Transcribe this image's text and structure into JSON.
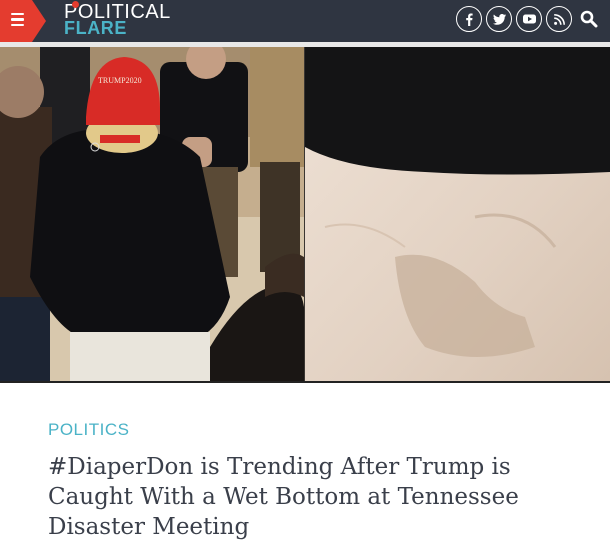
{
  "brand": {
    "top": "POLITICAL",
    "bottom": "FLARE",
    "accent_color": "#e43c2f",
    "teal_color": "#4bb3c7",
    "header_bg": "#2f3541"
  },
  "nav": {
    "menu_icon": "hamburger-icon"
  },
  "social_icons": [
    "facebook-icon",
    "twitter-icon",
    "youtube-icon",
    "rss-icon",
    "search-icon"
  ],
  "hero": {
    "cap_text": "TRUMP2020"
  },
  "article": {
    "category": "POLITICS",
    "headline": "#DiaperDon is Trending After Trump is Caught With a Wet Bottom at Tennessee Disaster Meeting"
  }
}
